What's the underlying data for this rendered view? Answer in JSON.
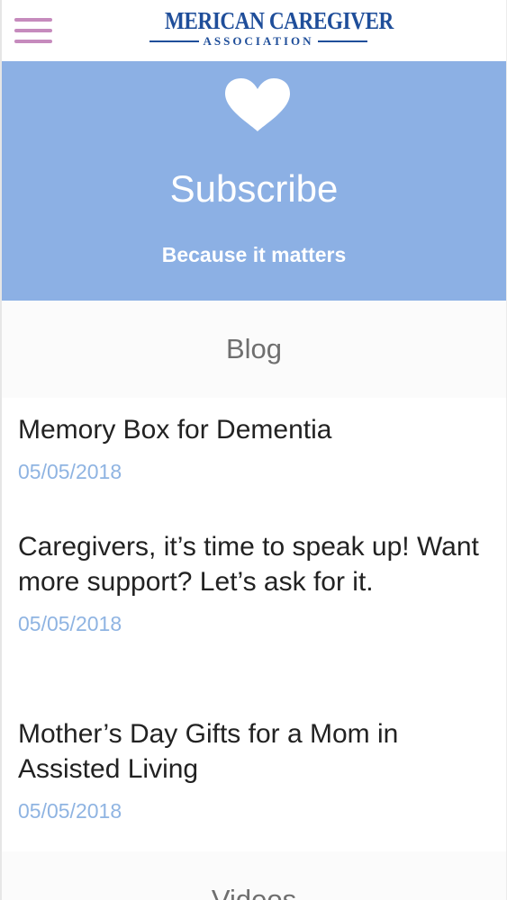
{
  "header": {
    "logo_top": "MERICAN CAREGIVER",
    "logo_bottom": "ASSOCIATION",
    "menu_icon": "hamburger-menu-icon",
    "logo_color": "#1f4e9a",
    "menu_color": "#c68bbd"
  },
  "banner": {
    "icon": "heart-icon",
    "title": "Subscribe",
    "subtitle": "Because it matters",
    "background": "#8cb0e4"
  },
  "blog": {
    "heading": "Blog",
    "posts": [
      {
        "title": "Memory Box for Dementia",
        "date": "05/05/2018"
      },
      {
        "title": "Caregivers, it’s time to speak up! Want more support? Let’s ask for it.",
        "date": "05/05/2018"
      },
      {
        "title": "Mother’s Day Gifts for a Mom in Assisted Living",
        "date": "05/05/2018"
      }
    ],
    "date_color": "#8fb4e2"
  },
  "videos": {
    "heading": "Videos"
  }
}
